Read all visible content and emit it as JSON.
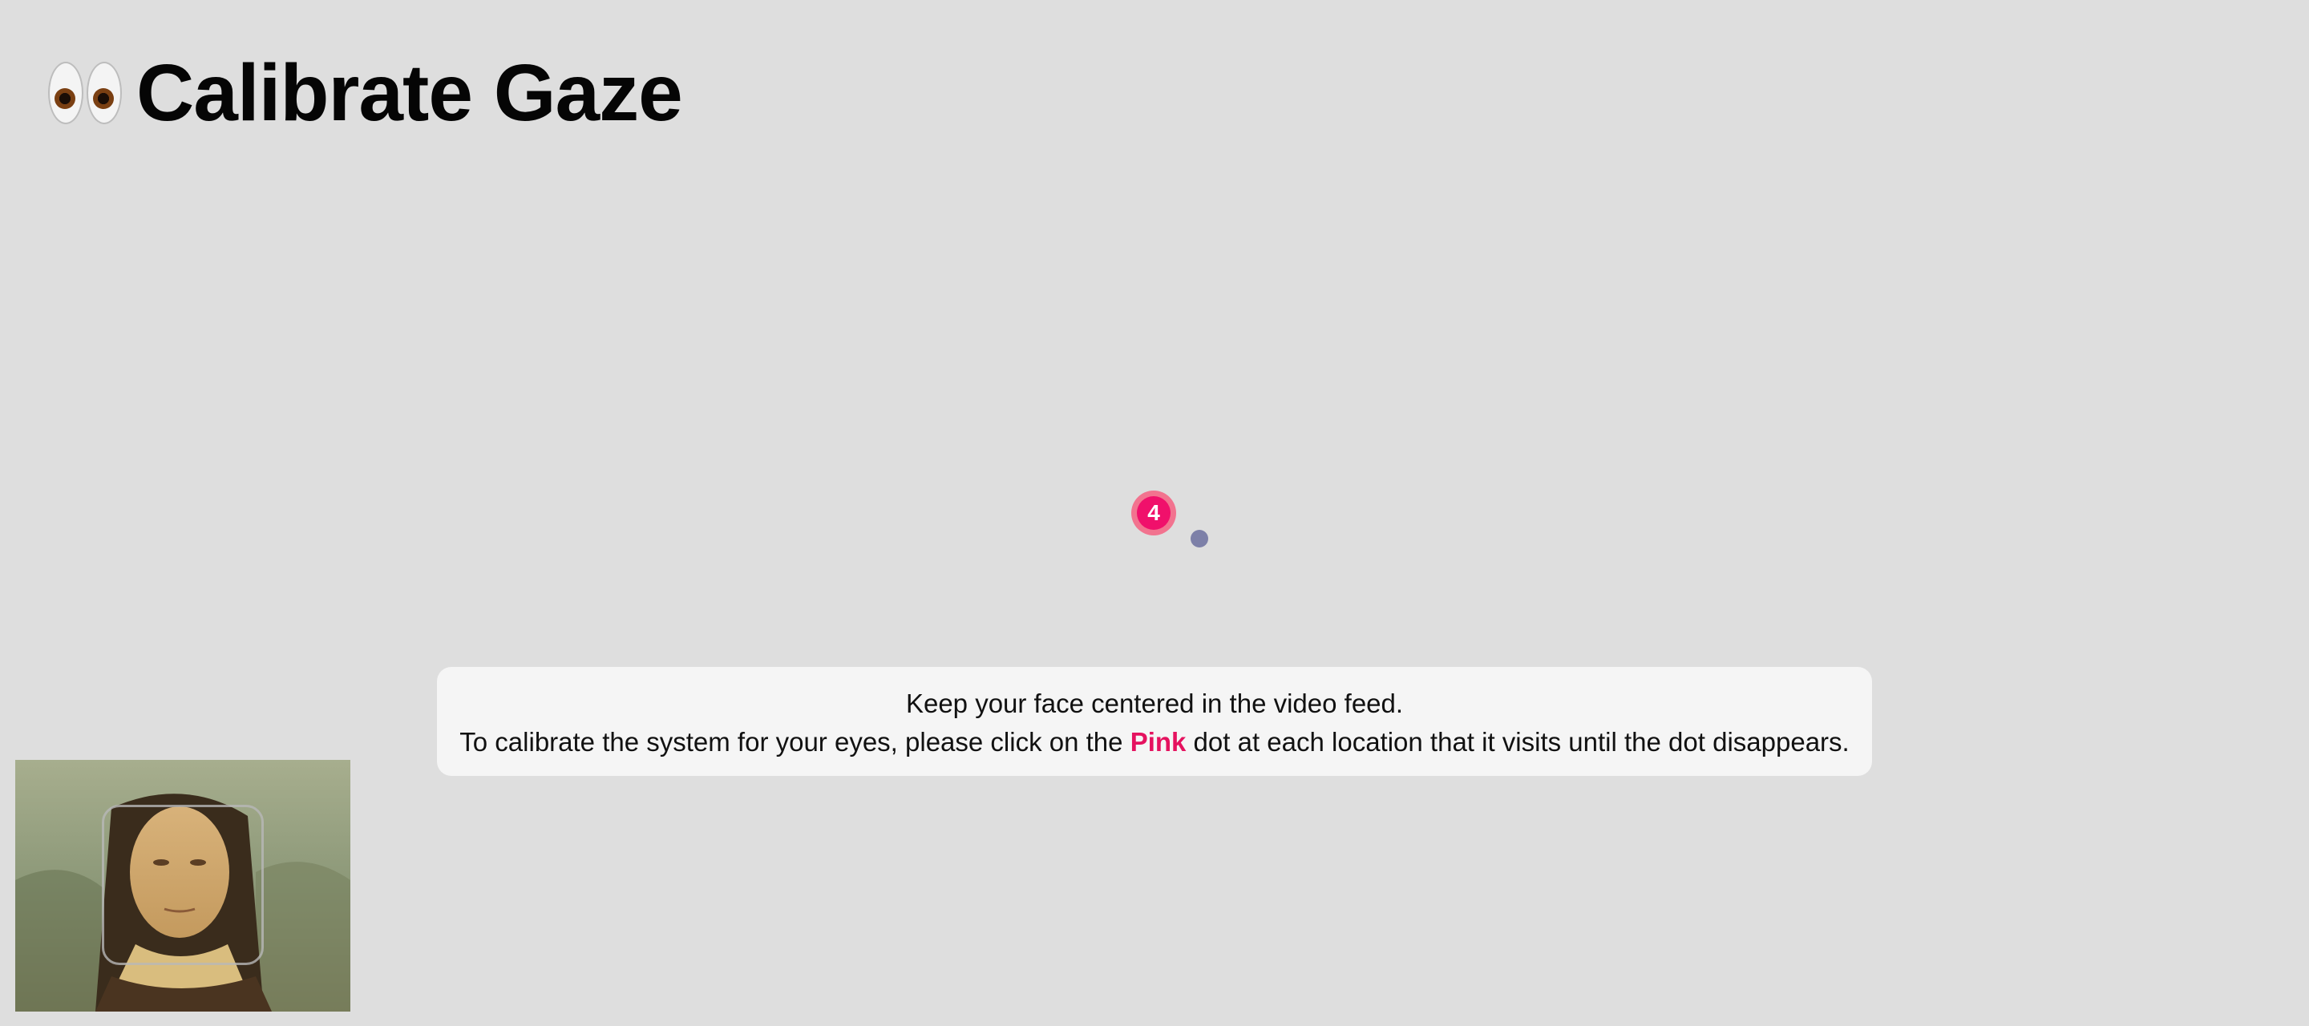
{
  "header": {
    "emoji": "👀",
    "emoji_icon": "eyes-icon",
    "title": "Calibrate Gaze"
  },
  "calibration": {
    "dot_label": "4",
    "dot_color": "#f0106b",
    "gaze_dot_color": "#7d80a8"
  },
  "instructions": {
    "line1": "Keep your face centered in the video feed.",
    "line2_prefix": "To calibrate the system for your eyes, please click on the ",
    "line2_highlight": "Pink",
    "line2_suffix": " dot at each location that it visits until the dot disappears."
  },
  "colors": {
    "background": "#dedede",
    "panel": "#f5f5f5",
    "accent_pink": "#e5125f"
  }
}
